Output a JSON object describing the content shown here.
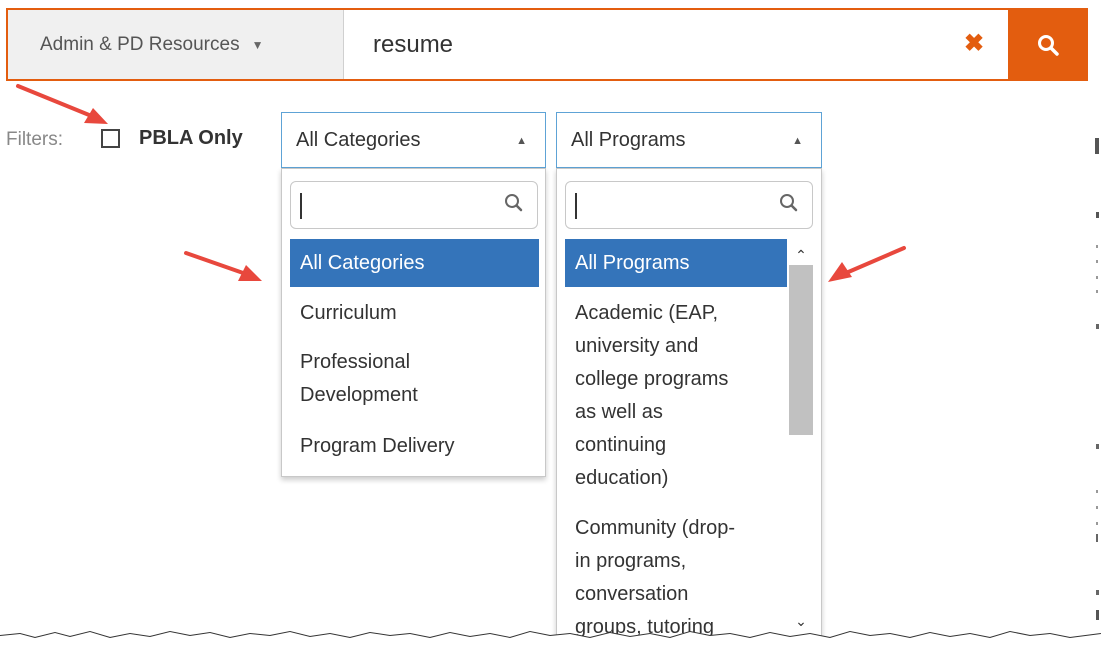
{
  "search": {
    "scope_label": "Admin & PD Resources",
    "query": "resume"
  },
  "filters": {
    "label": "Filters:",
    "pbla_label": "PBLA Only",
    "pbla_checked": false
  },
  "categories": {
    "selected": "All Categories",
    "options": [
      "All Categories",
      "Curriculum",
      "Professional",
      "Development",
      "Program Delivery"
    ]
  },
  "programs": {
    "selected": "All Programs",
    "options": [
      "All Programs",
      "Academic (EAP,",
      "university and",
      "college programs",
      "as well as",
      "continuing",
      "education)",
      "Community (drop-",
      "in programs,",
      "conversation",
      "groups, tutoring"
    ]
  },
  "colors": {
    "accent": "#e35d0f",
    "selected_bg": "#3474ba",
    "select_border": "#5ea3d6",
    "annotation_arrow": "#e8483d"
  }
}
